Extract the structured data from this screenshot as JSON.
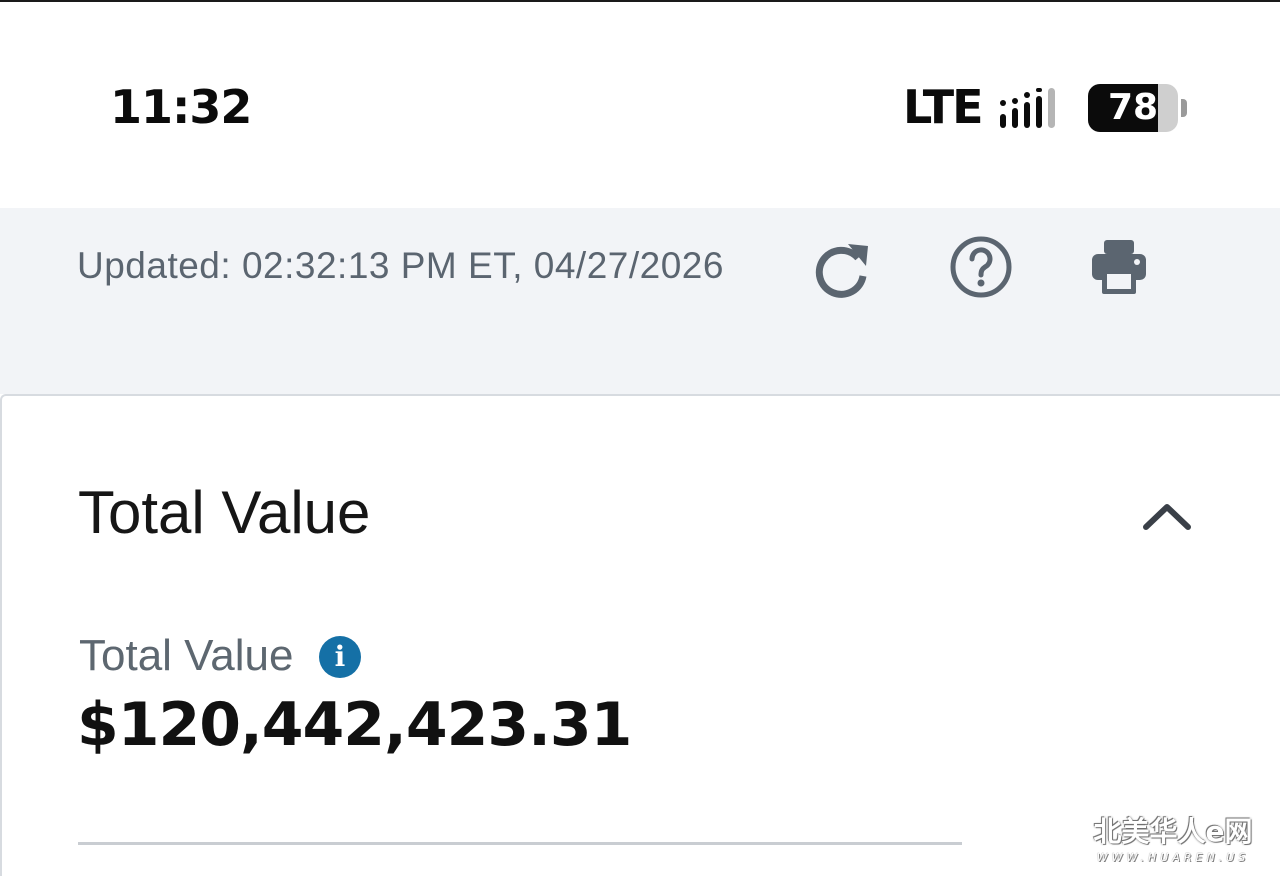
{
  "status_bar": {
    "time": "11:32",
    "network": "LTE",
    "battery_level": "78",
    "battery_percent": 78
  },
  "toolbar": {
    "updated_text": "Updated: 02:32:13 PM ET, 04/27/2026",
    "icons": [
      "refresh-icon",
      "help-icon",
      "print-icon"
    ]
  },
  "card": {
    "title": "Total Value",
    "value_label": "Total Value",
    "info_icon_glyph": "i",
    "value_amount": "$120,442,423.31"
  },
  "watermark": {
    "main": "北美华人e网",
    "sub": "WWW.HUAREN.US"
  },
  "colors": {
    "toolbar_bg": "#f2f4f7",
    "icon_gray": "#5b6570",
    "info_blue": "#1570a6",
    "text_dark": "#111111"
  }
}
